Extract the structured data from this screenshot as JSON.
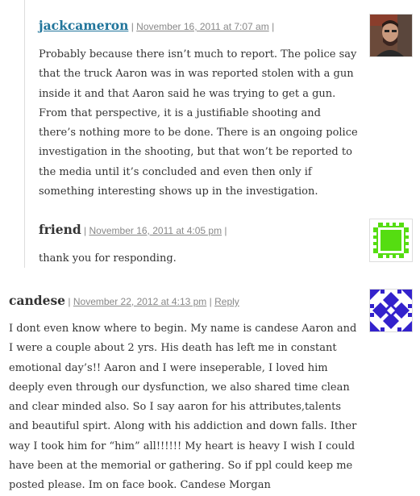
{
  "comments": [
    {
      "author": "jackcameron",
      "date": "November 16, 2011 at 7:07 am",
      "separator": "|",
      "trailing_separator": "|",
      "body": "Probably because there isn’t much to report. The police say that the truck Aaron was in was reported stolen with a gun inside it and that Aaron said he was trying to get a gun. From that perspective, it is a justifiable shooting and there’s nothing more to be done. There is an ongoing police investigation in the shooting, but that won’t be reported to the media until it’s concluded and even then only if something interesting shows up in the investigation."
    },
    {
      "author": "friend",
      "date": "November 16, 2011 at 4:05 pm",
      "separator": "|",
      "trailing_separator": "|",
      "body": "thank you for responding."
    },
    {
      "author": "candese",
      "date": "November 22, 2012 at 4:13 pm",
      "separator": "|",
      "reply_label": "Reply",
      "body": "I dont even know where to begin. My name is candese Aaron and I were a couple about 2 yrs. His death has left me in constant emotional day’s!! Aaron and I were inseperable, I loved him deeply even through our dysfunction, we also shared time clean and clear minded also. So I say aaron for his attributes,talents and beautiful spirt. Along with his addiction and down falls. Ither way I took him for “him” all!!!!!! My heart is heavy I wish I could have been at the memorial or gathering. So if ppl could keep me posted please. Im on face book. Candese Morgan"
    }
  ],
  "colors": {
    "author_link": "#21759b",
    "meta": "#888888",
    "text": "#333333",
    "green_avatar": "#55dd11",
    "blue_avatar": "#3322cc"
  }
}
